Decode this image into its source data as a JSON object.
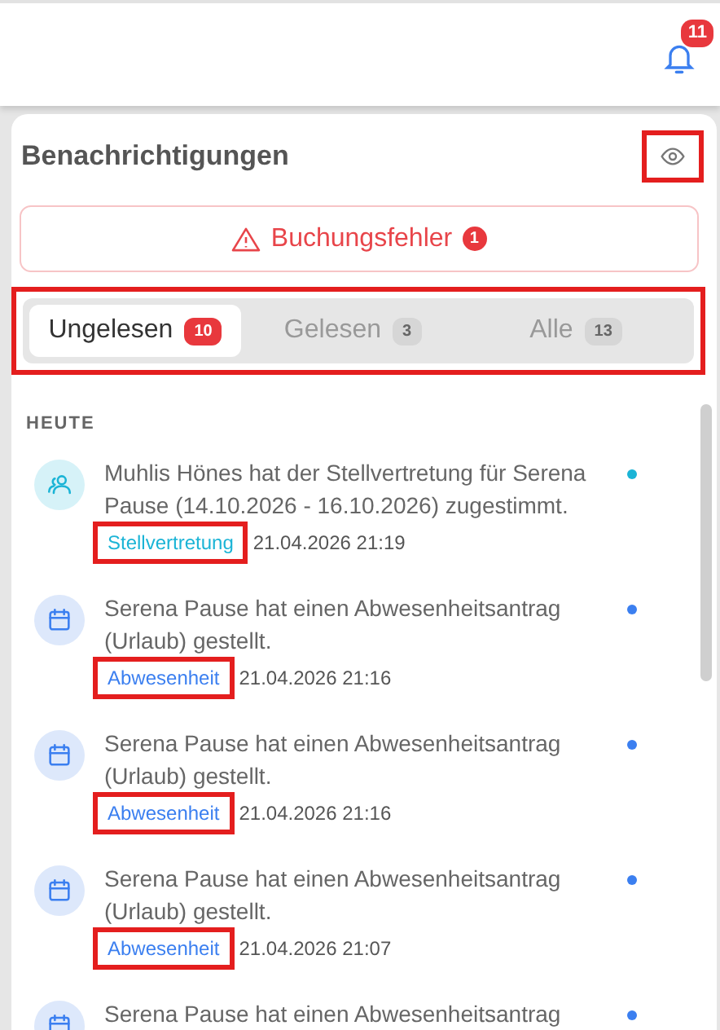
{
  "topbar": {
    "bell_badge": "11"
  },
  "panel": {
    "title": "Benachrichtigungen",
    "eye_highlighted": true
  },
  "alert": {
    "label": "Buchungsfehler",
    "count": "1"
  },
  "tabs_highlighted": true,
  "tabs": [
    {
      "label": "Ungelesen",
      "count": "10",
      "selected": true
    },
    {
      "label": "Gelesen",
      "count": "3",
      "selected": false
    },
    {
      "label": "Alle",
      "count": "13",
      "selected": false
    }
  ],
  "section": "HEUTE",
  "notifications": [
    {
      "kind": "substitution",
      "text": "Muhlis Hönes hat der Stellvertretung für Serena Pause (14.10.2026 - 16.10.2026) zugestimmt.",
      "tag": "Stellvertretung",
      "tag_highlighted": true,
      "time": "21.04.2026 21:19",
      "unread": true,
      "color": "#1bb4d6"
    },
    {
      "kind": "absence",
      "text": "Serena Pause hat einen Abwesenheitsantrag (Urlaub) gestellt.",
      "tag": "Abwesenheit",
      "tag_highlighted": true,
      "time": "21.04.2026 21:16",
      "unread": true,
      "color": "#3b7ff0"
    },
    {
      "kind": "absence",
      "text": "Serena Pause hat einen Abwesenheitsantrag (Urlaub) gestellt.",
      "tag": "Abwesenheit",
      "tag_highlighted": true,
      "time": "21.04.2026 21:16",
      "unread": true,
      "color": "#3b7ff0"
    },
    {
      "kind": "absence",
      "text": "Serena Pause hat einen Abwesenheitsantrag (Urlaub) gestellt.",
      "tag": "Abwesenheit",
      "tag_highlighted": true,
      "time": "21.04.2026 21:07",
      "unread": true,
      "color": "#3b7ff0"
    },
    {
      "kind": "absence",
      "text": "Serena Pause hat einen Abwesenheitsantrag",
      "unread": true,
      "color": "#3b7ff0"
    }
  ]
}
